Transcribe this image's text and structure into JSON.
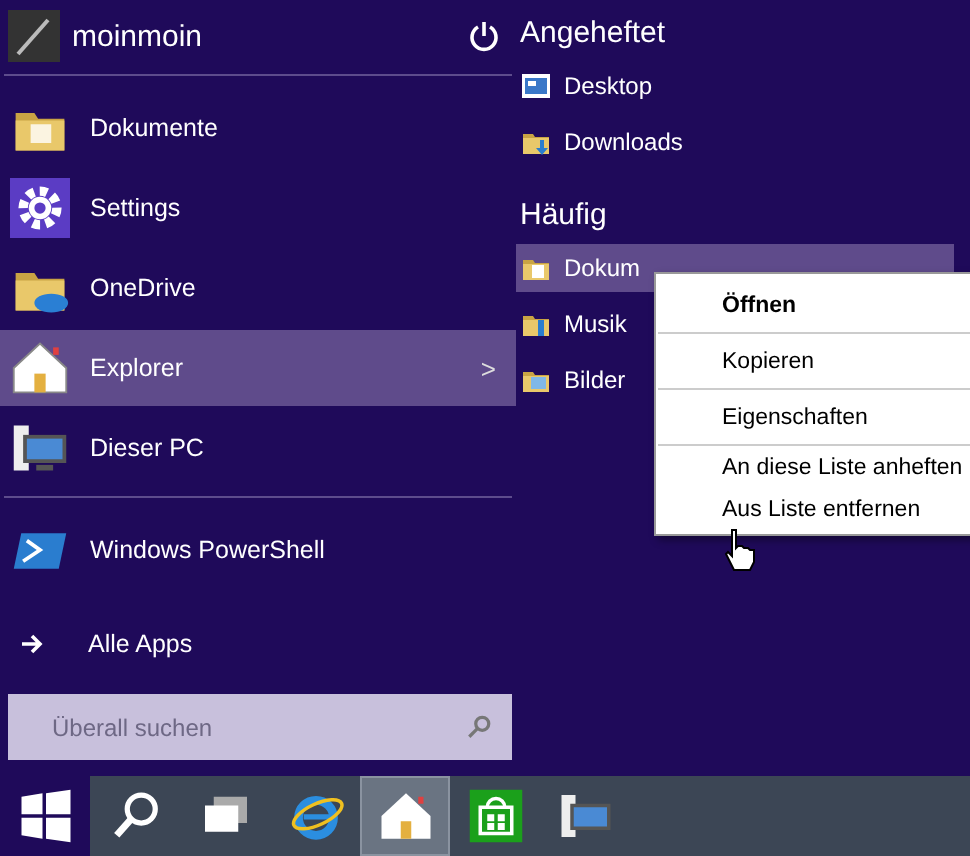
{
  "user": {
    "name": "moinmoin"
  },
  "apps": [
    {
      "label": "Dokumente",
      "kind": "folder",
      "selected": false
    },
    {
      "label": "Settings",
      "kind": "settings",
      "selected": false
    },
    {
      "label": "OneDrive",
      "kind": "onedrive",
      "selected": false
    },
    {
      "label": "Explorer",
      "kind": "explorer",
      "selected": true,
      "arrow": ">"
    },
    {
      "label": "Dieser PC",
      "kind": "pc",
      "selected": false
    }
  ],
  "extra_apps": [
    {
      "label": "Windows PowerShell",
      "kind": "powershell",
      "selected": false
    }
  ],
  "all_apps": {
    "label": "Alle Apps"
  },
  "search": {
    "placeholder": "Überall suchen"
  },
  "pinned": {
    "title": "Angeheftet",
    "items": [
      {
        "label": "Desktop",
        "kind": "desktop",
        "selected": false
      },
      {
        "label": "Downloads",
        "kind": "downloads",
        "selected": false
      }
    ]
  },
  "frequent": {
    "title": "Häufig",
    "items": [
      {
        "label": "Dokum",
        "kind": "documents",
        "selected": true
      },
      {
        "label": "Musik",
        "kind": "music",
        "selected": false
      },
      {
        "label": "Bilder",
        "kind": "pictures",
        "selected": false
      }
    ]
  },
  "context_menu": [
    {
      "label": "Öffnen",
      "bold": true,
      "divider_after": true
    },
    {
      "label": "Kopieren",
      "bold": false,
      "divider_after": true
    },
    {
      "label": "Eigenschaften",
      "bold": false,
      "divider_after": true
    },
    {
      "label": "An diese Liste anheften",
      "bold": false,
      "divider_after": false
    },
    {
      "label": "Aus Liste entfernen",
      "bold": false,
      "divider_after": false
    }
  ],
  "taskbar": [
    {
      "kind": "start",
      "active": false
    },
    {
      "kind": "search",
      "active": false
    },
    {
      "kind": "taskview",
      "active": false
    },
    {
      "kind": "ie",
      "active": false
    },
    {
      "kind": "explorer",
      "active": true
    },
    {
      "kind": "store",
      "active": false
    },
    {
      "kind": "pc",
      "active": false
    }
  ]
}
